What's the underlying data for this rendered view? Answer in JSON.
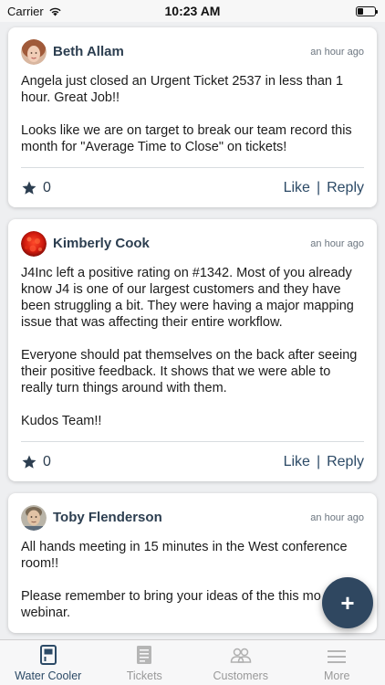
{
  "status_bar": {
    "carrier": "Carrier",
    "time": "10:23 AM",
    "battery_level": 0.35
  },
  "posts": [
    {
      "author": "Beth Allam",
      "time": "an hour ago",
      "paragraphs": [
        "Angela just closed an Urgent Ticket 2537 in less than 1 hour. Great Job!!",
        "Looks like we are on target to break our team record this month for \"Average Time to Close\" on tickets!"
      ],
      "star_count": "0",
      "like_label": "Like",
      "separator": "|",
      "reply_label": "Reply"
    },
    {
      "author": "Kimberly Cook",
      "time": "an hour ago",
      "paragraphs": [
        "J4Inc left a positive rating on #1342.  Most of you already know J4 is one of our largest customers and they have been struggling a bit.  They were having a major mapping issue that was affecting their entire workflow.",
        "Everyone should pat themselves on the back after seeing their positive feedback.  It shows that we were able to really turn things around with them.",
        "Kudos Team!!"
      ],
      "star_count": "0",
      "like_label": "Like",
      "separator": "|",
      "reply_label": "Reply"
    },
    {
      "author": "Toby Flenderson",
      "time": "an hour ago",
      "paragraphs": [
        "All hands meeting in 15 minutes in the West conference room!!",
        "Please remember to bring your ideas of the this mo webinar."
      ]
    }
  ],
  "fab": {
    "label": "+"
  },
  "tabs": [
    {
      "label": "Water Cooler",
      "icon": "water-cooler-icon",
      "active": true
    },
    {
      "label": "Tickets",
      "icon": "tickets-icon",
      "active": false
    },
    {
      "label": "Customers",
      "icon": "customers-icon",
      "active": false
    },
    {
      "label": "More",
      "icon": "more-icon",
      "active": false
    }
  ],
  "colors": {
    "accent": "#2c4a66",
    "fab": "#2f4760",
    "background": "#eeeff1"
  }
}
